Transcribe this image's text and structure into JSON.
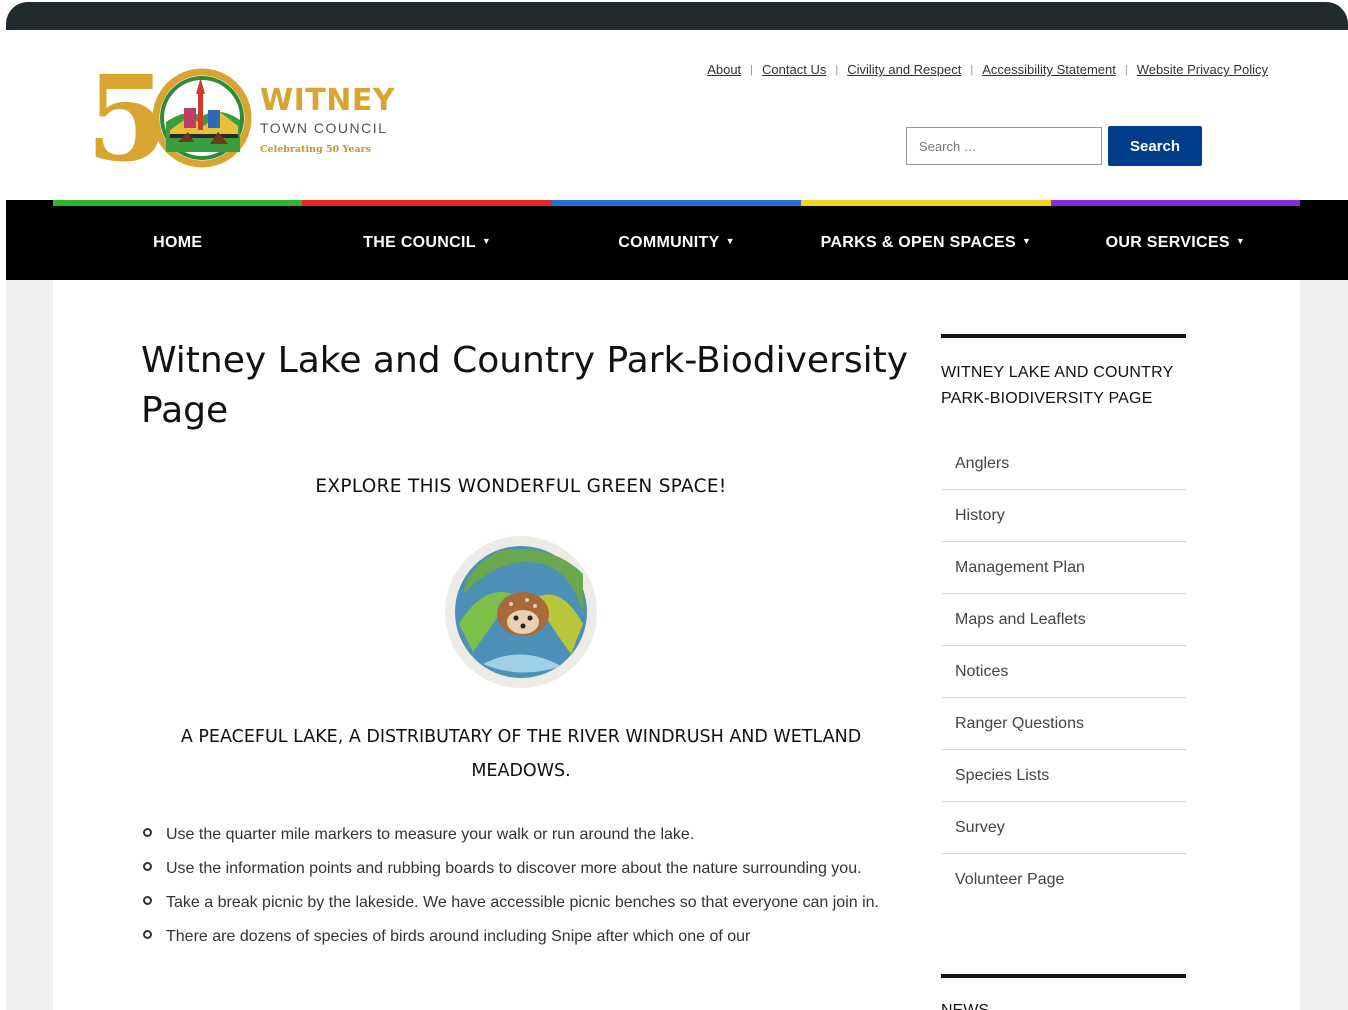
{
  "header": {
    "logo": {
      "number": "5",
      "title": "WITNEY",
      "subtitle": "TOWN COUNCIL",
      "tagline": "Celebrating 50 Years"
    },
    "top_links": [
      "About",
      "Contact Us",
      "Civility and Respect",
      "Accessibility Statement",
      "Website Privacy Policy"
    ],
    "search": {
      "placeholder": "Search …",
      "button_label": "Search"
    }
  },
  "nav": {
    "stripe_colors": [
      "#2db52d",
      "#e32828",
      "#2a6fd6",
      "#f2d21b",
      "#8a2be2"
    ],
    "items": [
      {
        "label": "HOME",
        "has_dropdown": false
      },
      {
        "label": "THE COUNCIL",
        "has_dropdown": true
      },
      {
        "label": "COMMUNITY",
        "has_dropdown": true
      },
      {
        "label": "PARKS & OPEN SPACES",
        "has_dropdown": true
      },
      {
        "label": "OUR SERVICES",
        "has_dropdown": true
      }
    ]
  },
  "main": {
    "title": "Witney Lake and Country Park-Biodiversity Page",
    "explore_heading": "EXPLORE THIS WONDERFUL GREEN SPACE!",
    "peaceful_text": "A PEACEFUL LAKE, A DISTRIBUTARY OF THE RIVER WINDRUSH AND WETLAND MEADOWS.",
    "bullets": [
      "Use the quarter mile markers to measure your walk or run around the lake.",
      "Use the information points and rubbing boards to discover more about the nature surrounding you.",
      "Take a break picnic by the lakeside. We have accessible picnic benches so that everyone can join in.",
      "There are dozens of species of birds around including Snipe after which one of our"
    ]
  },
  "sidebar": {
    "heading": "WITNEY LAKE AND COUNTRY PARK-BIODIVERSITY PAGE",
    "items": [
      "Anglers",
      "History",
      "Management Plan",
      "Maps and Leaflets",
      "Notices",
      "Ranger Questions",
      "Species Lists",
      "Survey",
      "Volunteer Page"
    ],
    "news_heading": "NEWS"
  },
  "colors": {
    "brand_gold": "#d9a531",
    "search_button": "#003e8c",
    "nav_background": "#000000"
  }
}
